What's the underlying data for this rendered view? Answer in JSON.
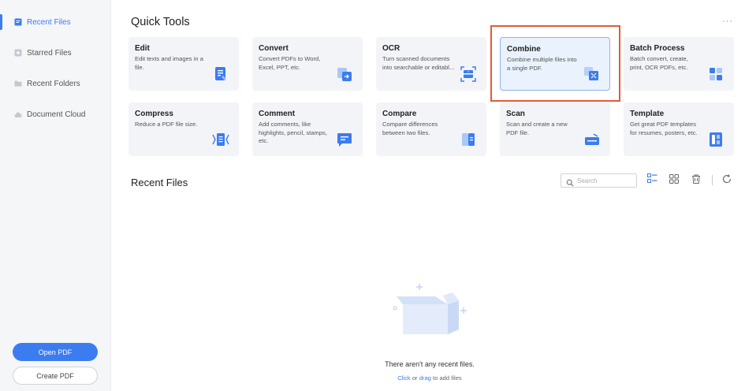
{
  "sidebar": {
    "items": [
      {
        "label": "Recent Files",
        "icon": "recent-files-icon",
        "active": true
      },
      {
        "label": "Starred Files",
        "icon": "star-icon",
        "active": false
      },
      {
        "label": "Recent Folders",
        "icon": "folder-icon",
        "active": false
      },
      {
        "label": "Document Cloud",
        "icon": "cloud-icon",
        "active": false
      }
    ],
    "open_pdf": "Open PDF",
    "create_pdf": "Create PDF"
  },
  "quick_tools": {
    "title": "Quick Tools",
    "more": "···",
    "cards": [
      {
        "title": "Edit",
        "desc": "Edit texts and images in a file.",
        "icon": "edit-icon"
      },
      {
        "title": "Convert",
        "desc": "Convert PDFs to Word, Excel, PPT, etc.",
        "icon": "convert-icon"
      },
      {
        "title": "OCR",
        "desc": "Turn scanned documents into searchable or editabl...",
        "icon": "ocr-icon"
      },
      {
        "title": "Combine",
        "desc": "Combine multiple files into a single PDF.",
        "icon": "combine-icon"
      },
      {
        "title": "Batch Process",
        "desc": "Batch convert, create, print, OCR PDFs, etc.",
        "icon": "batch-process-icon"
      },
      {
        "title": "Compress",
        "desc": "Reduce a PDF file size.",
        "icon": "compress-icon"
      },
      {
        "title": "Comment",
        "desc": "Add comments, like highlights, pencil, stamps, etc.",
        "icon": "comment-icon"
      },
      {
        "title": "Compare",
        "desc": "Compare differences between two files.",
        "icon": "compare-icon"
      },
      {
        "title": "Scan",
        "desc": "Scan and create a new PDF file.",
        "icon": "scan-icon"
      },
      {
        "title": "Template",
        "desc": "Get great PDF templates for resumes, posters, etc.",
        "icon": "template-icon"
      }
    ]
  },
  "recent": {
    "title": "Recent Files",
    "search_placeholder": "Search",
    "empty_title": "There aren't any recent files.",
    "empty_click": "Click",
    "empty_or": " or ",
    "empty_drag": "drag",
    "empty_rest": " to add files"
  },
  "colors": {
    "accent": "#3b7cf0",
    "highlight": "#e35a35"
  }
}
